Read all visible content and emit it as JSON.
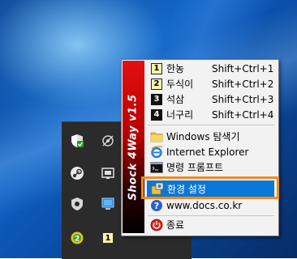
{
  "window": {
    "title": "Shock 4Way v1.5 tray menu"
  },
  "banner": {
    "text": "Shock 4Way v1.5"
  },
  "menu": {
    "modes": [
      {
        "num": "1",
        "label": "한농",
        "shortcut": "Shift+Ctrl+1"
      },
      {
        "num": "2",
        "label": "두식이",
        "shortcut": "Shift+Ctrl+2"
      },
      {
        "num": "3",
        "label": "석삼",
        "shortcut": "Shift+Ctrl+3"
      },
      {
        "num": "4",
        "label": "너구리",
        "shortcut": "Shift+Ctrl+4"
      }
    ],
    "tools": [
      {
        "label": "Windows 탐색기",
        "icon": "folder-icon"
      },
      {
        "label": "Internet Explorer",
        "icon": "ie-icon"
      },
      {
        "label": "명령 프롬프트",
        "icon": "cmd-icon"
      }
    ],
    "settings": {
      "label": "환경 설정",
      "icon": "settings-icon"
    },
    "website": {
      "label": "www.docs.co.kr",
      "icon": "help-icon"
    },
    "exit": {
      "label": "종료",
      "icon": "power-icon"
    }
  },
  "tray": {
    "badge_number": "2",
    "mode_indicator": "1",
    "icons": [
      "defender-icon",
      "network-icon",
      "steam-icon",
      "display-icon",
      "shield-icon",
      "monitor-icon",
      "update-badge-icon",
      "mode-indicator-icon"
    ]
  },
  "colors": {
    "selection": "#0a78d7",
    "highlight_box": "#f28a1e",
    "banner": "#e31010"
  }
}
